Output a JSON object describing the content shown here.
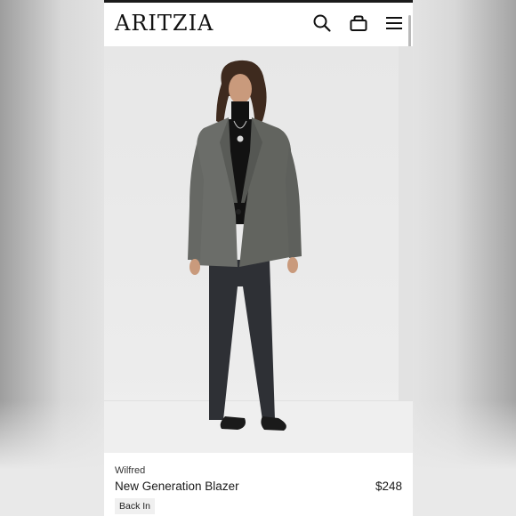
{
  "header": {
    "logo": "ARITZIA",
    "icons": [
      "search-icon",
      "shopping-bag-icon",
      "menu-icon"
    ]
  },
  "product": {
    "brand": "Wilfred",
    "name": "New Generation Blazer",
    "price": "$248",
    "badge": "Back In"
  },
  "colors": {
    "background": "#ffffff",
    "text": "#1a1a1a",
    "badge_bg": "#f0f0f0",
    "blazer": "#6b6d69",
    "jeans": "#2e3035"
  }
}
